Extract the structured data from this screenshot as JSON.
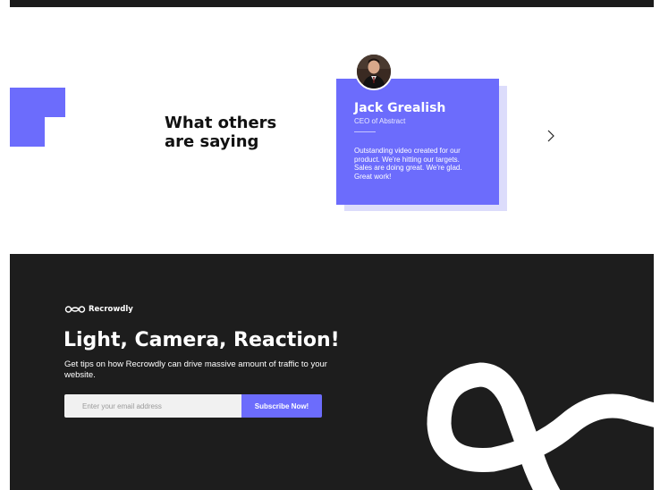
{
  "testimonials": {
    "heading": "What others are saying",
    "card": {
      "name": "Jack Grealish",
      "role": "CEO of Abstract",
      "quote": "Outstanding video created for our product. We're hitting our targets. Sales are doing great. We're glad. Great work!"
    }
  },
  "footer": {
    "logo_text": "Recrowdly",
    "title": "Light, Camera, Reaction!",
    "subtitle": "Get tips on how Recrowdly can drive massive amount of traffic to your website.",
    "email_placeholder": "Enter your email address",
    "subscribe_label": "Subscribe Now!"
  },
  "colors": {
    "accent": "#6c6cfc",
    "dark": "#1d1d1d",
    "card_shadow": "#dcdcfb"
  },
  "icons": {
    "next": "chevron-right-icon",
    "logo": "infinity-logo-icon"
  }
}
